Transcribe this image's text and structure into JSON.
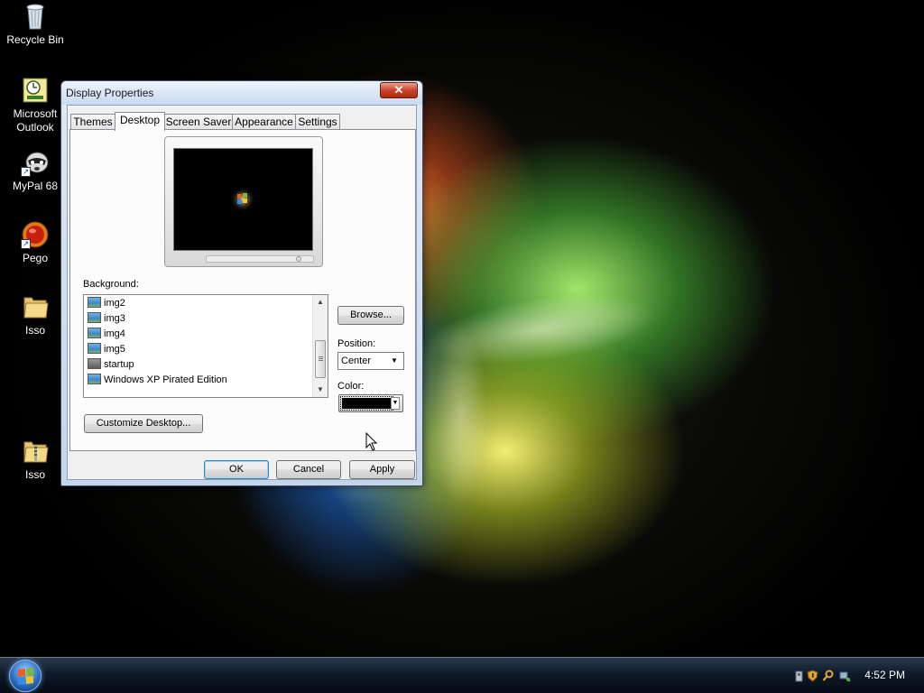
{
  "desktop": {
    "icons": [
      {
        "label": "Recycle Bin",
        "icon": "recycle-bin-icon"
      },
      {
        "label": "Microsoft Outlook",
        "icon": "outlook-icon"
      },
      {
        "label": "MyPal 68",
        "icon": "mypal-icon"
      },
      {
        "label": "Pego",
        "icon": "pego-icon"
      },
      {
        "label": "Isso",
        "icon": "folder-icon"
      },
      {
        "label": "Isso",
        "icon": "zip-folder-icon"
      }
    ]
  },
  "window": {
    "title": "Display Properties",
    "close_symbol": "✕",
    "tabs": [
      {
        "label": "Themes"
      },
      {
        "label": "Desktop",
        "active": true
      },
      {
        "label": "Screen Saver"
      },
      {
        "label": "Appearance"
      },
      {
        "label": "Settings"
      }
    ],
    "background_label": "Background:",
    "background_list": [
      {
        "label": "img2",
        "icon": "image-icon"
      },
      {
        "label": "img3",
        "icon": "image-icon"
      },
      {
        "label": "img4",
        "icon": "image-icon"
      },
      {
        "label": "img5",
        "icon": "image-icon"
      },
      {
        "label": "startup",
        "icon": "image-gray-icon"
      },
      {
        "label": "Windows XP Pirated Edition",
        "icon": "image-icon"
      }
    ],
    "browse_label": "Browse...",
    "position_label": "Position:",
    "position_value": "Center",
    "color_label": "Color:",
    "color_value": "#000000",
    "customize_label": "Customize Desktop...",
    "ok_label": "OK",
    "cancel_label": "Cancel",
    "apply_label": "Apply"
  },
  "taskbar": {
    "clock": "4:52 PM",
    "tray_icons": [
      "usb-icon",
      "shield-icon",
      "search-icon",
      "network-icon"
    ]
  },
  "colors": {
    "taskbar": "#0e1a29",
    "close_button": "#c9442b",
    "dialog_bg": "#f0f0f0"
  }
}
